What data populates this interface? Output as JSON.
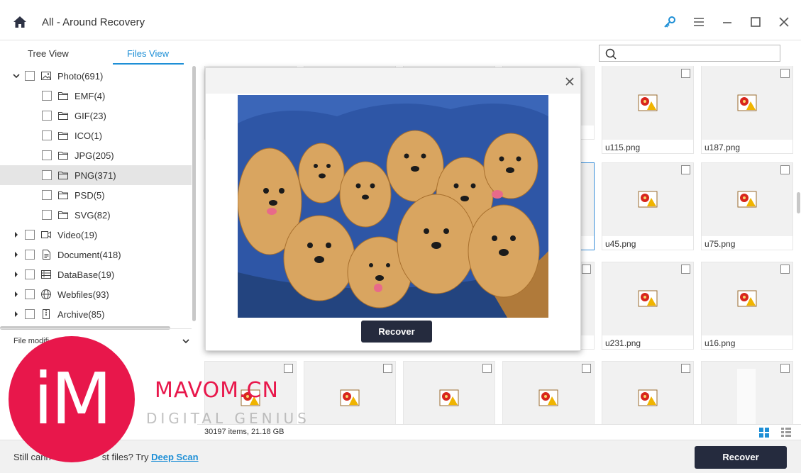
{
  "window": {
    "title": "All - Around Recovery"
  },
  "tabs": [
    {
      "label": "Tree View",
      "active": false
    },
    {
      "label": "Files View",
      "active": true
    }
  ],
  "search": {
    "placeholder": ""
  },
  "tree": [
    {
      "label": "Photo(691)",
      "expanded": true,
      "icon": "photo-icon"
    },
    {
      "label": "EMF(4)",
      "icon": "folder-icon"
    },
    {
      "label": "GIF(23)",
      "icon": "folder-icon"
    },
    {
      "label": "ICO(1)",
      "icon": "folder-icon"
    },
    {
      "label": "JPG(205)",
      "icon": "folder-icon"
    },
    {
      "label": "PNG(371)",
      "icon": "folder-icon",
      "selected": true
    },
    {
      "label": "PSD(5)",
      "icon": "folder-icon"
    },
    {
      "label": "SVG(82)",
      "icon": "folder-icon"
    },
    {
      "label": "Video(19)",
      "icon": "video-icon"
    },
    {
      "label": "Document(418)",
      "icon": "document-icon"
    },
    {
      "label": "DataBase(19)",
      "icon": "database-icon"
    },
    {
      "label": "Webfiles(93)",
      "icon": "globe-icon"
    },
    {
      "label": "Archive(85)",
      "icon": "archive-icon"
    }
  ],
  "filter": {
    "label": "File modifi"
  },
  "files": [
    "u115.png",
    "u187.png",
    "u45.png",
    "u75.png",
    "u231.png",
    "u16.png"
  ],
  "preview": {
    "recover_label": "Recover"
  },
  "status": {
    "count": "30197 items, 21.18 GB"
  },
  "footer": {
    "message": "Still cann",
    "message_tail": "st files? Try ",
    "deep_scan": "Deep Scan",
    "recover_label": "Recover"
  },
  "watermark": {
    "logo": "iM",
    "brand": "MAVOM.CN",
    "tagline": "DIGITAL GENIUS"
  },
  "colors": {
    "accent": "#1e8fd6",
    "button": "#252b3e",
    "watermark": "#e8174b"
  }
}
